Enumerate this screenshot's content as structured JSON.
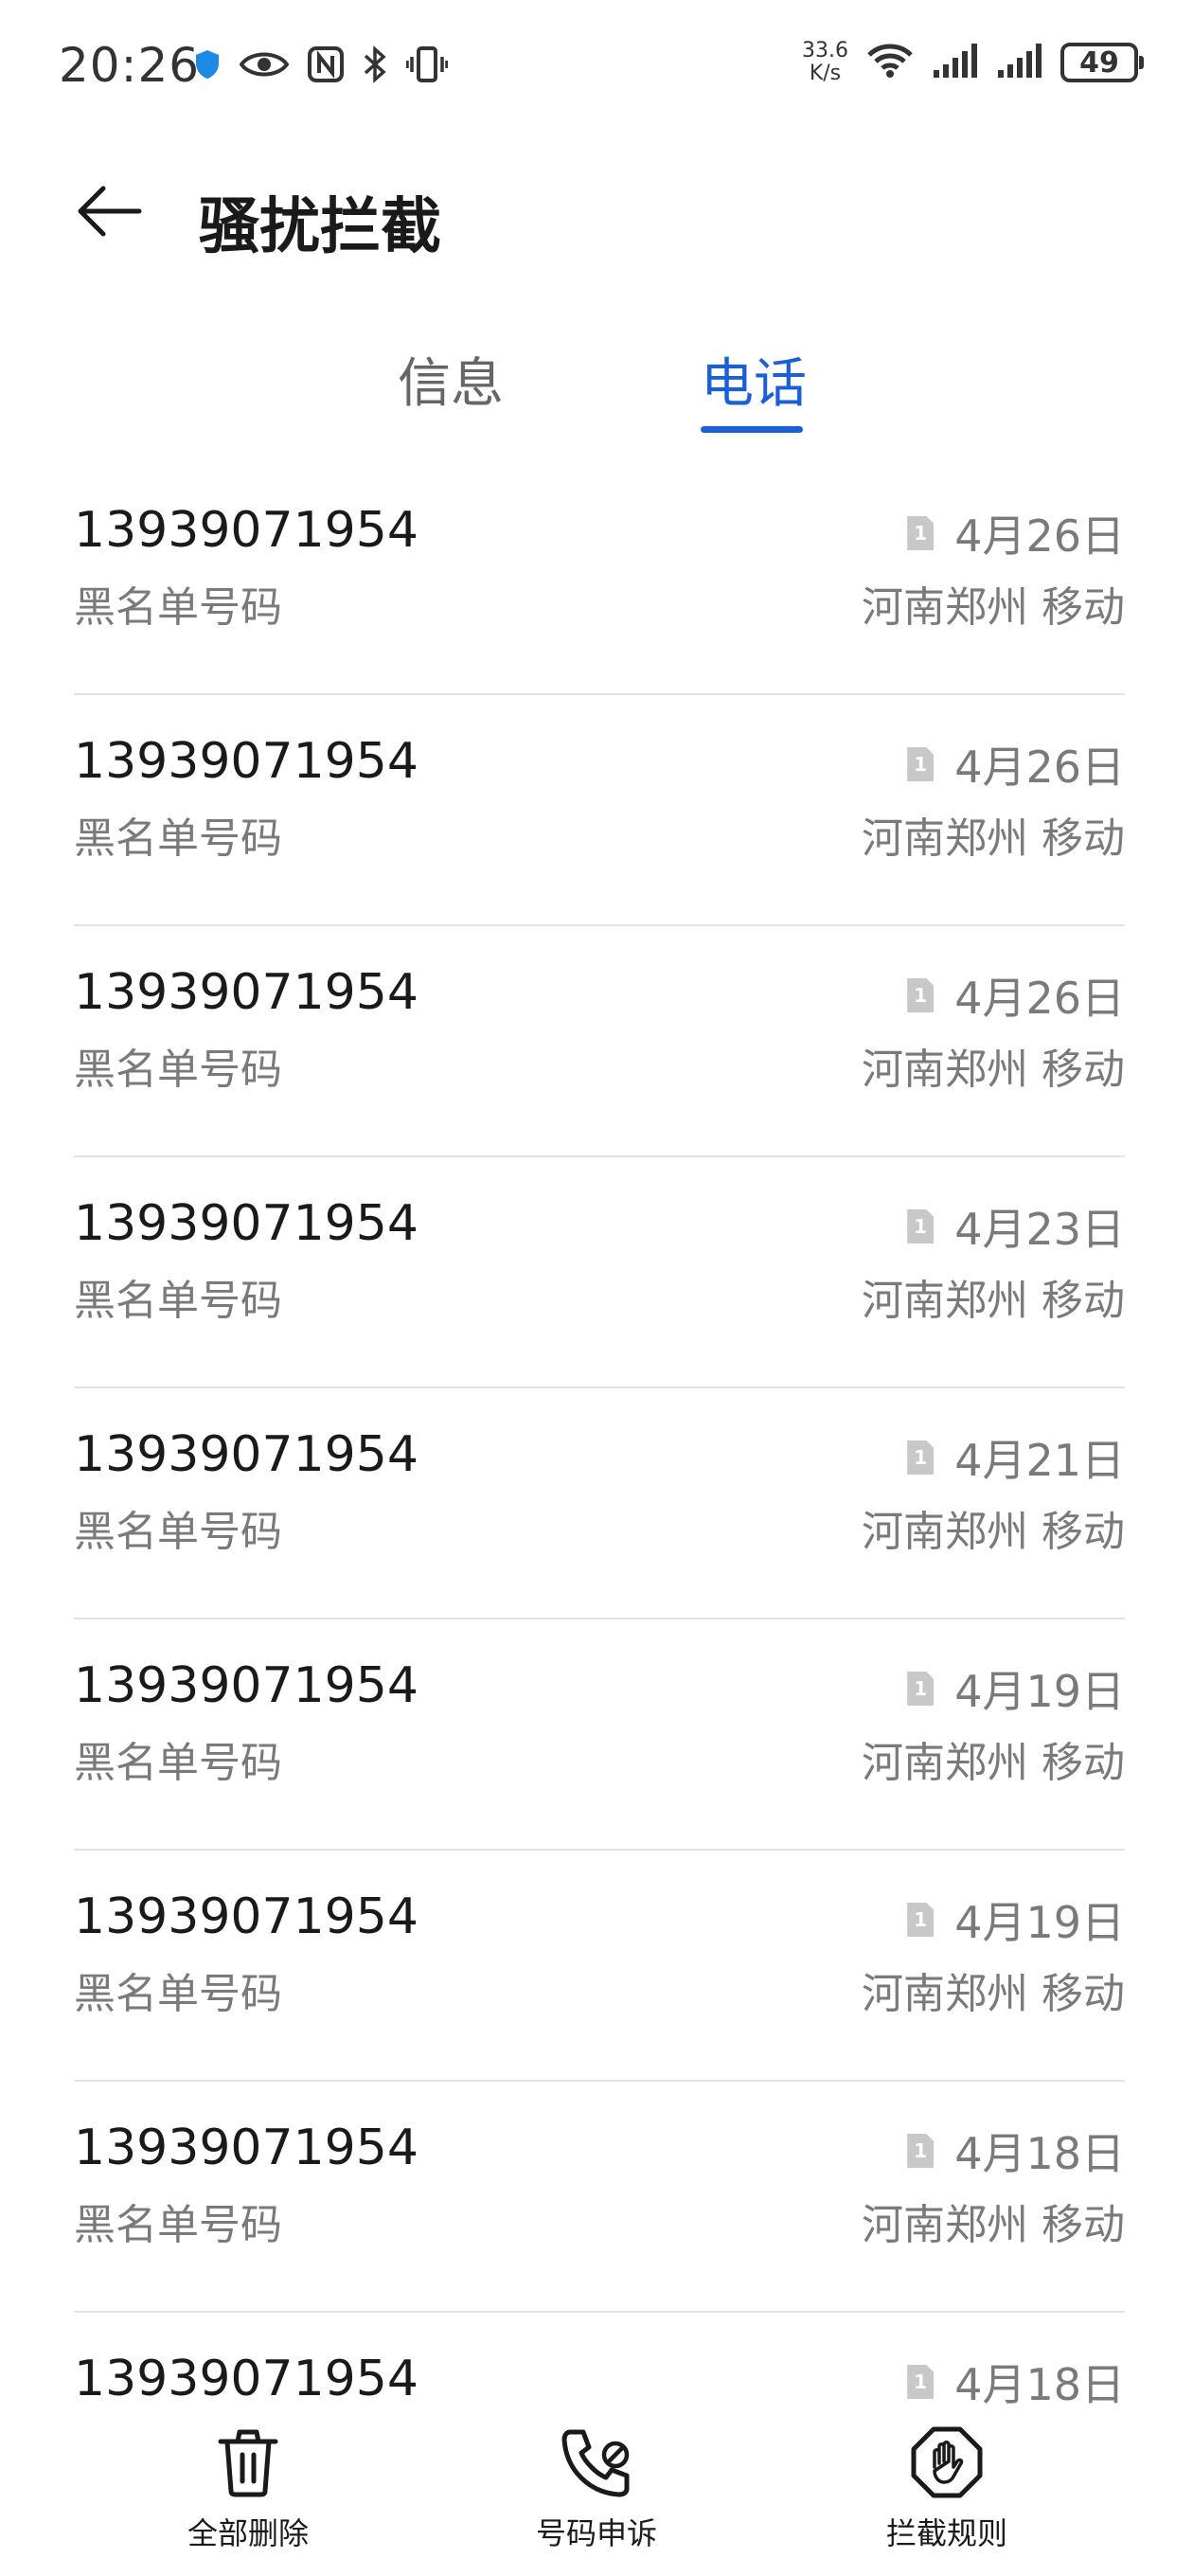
{
  "status_bar": {
    "time": "20:26",
    "net_speed_value": "33.6",
    "net_speed_unit": "K/s",
    "battery": "49",
    "icons": [
      "shield-icon",
      "eye-icon",
      "nfc-icon",
      "bluetooth-icon",
      "vibrate-icon",
      "wifi-icon",
      "signal-icon",
      "signal-icon"
    ]
  },
  "header": {
    "title": "骚扰拦截",
    "back_icon": "arrow-left-icon"
  },
  "tabs": [
    {
      "label": "信息",
      "active": false
    },
    {
      "label": "电话",
      "active": true
    }
  ],
  "colors": {
    "accent": "#1a5fd6",
    "secondary_text": "#7a7a7a",
    "divider": "#e2e2e2"
  },
  "calls": [
    {
      "number": "13939071954",
      "tag": "黑名单号码",
      "sim": "1",
      "date": "4月26日",
      "location": "河南郑州 移动"
    },
    {
      "number": "13939071954",
      "tag": "黑名单号码",
      "sim": "1",
      "date": "4月26日",
      "location": "河南郑州 移动"
    },
    {
      "number": "13939071954",
      "tag": "黑名单号码",
      "sim": "1",
      "date": "4月26日",
      "location": "河南郑州 移动"
    },
    {
      "number": "13939071954",
      "tag": "黑名单号码",
      "sim": "1",
      "date": "4月23日",
      "location": "河南郑州 移动"
    },
    {
      "number": "13939071954",
      "tag": "黑名单号码",
      "sim": "1",
      "date": "4月21日",
      "location": "河南郑州 移动"
    },
    {
      "number": "13939071954",
      "tag": "黑名单号码",
      "sim": "1",
      "date": "4月19日",
      "location": "河南郑州 移动"
    },
    {
      "number": "13939071954",
      "tag": "黑名单号码",
      "sim": "1",
      "date": "4月19日",
      "location": "河南郑州 移动"
    },
    {
      "number": "13939071954",
      "tag": "黑名单号码",
      "sim": "1",
      "date": "4月18日",
      "location": "河南郑州 移动"
    },
    {
      "number": "13939071954",
      "tag": "",
      "sim": "1",
      "date": "4月18日",
      "location": ""
    }
  ],
  "toolbar": {
    "delete_all_label": "全部删除",
    "delete_all_icon": "trash-icon",
    "appeal_label": "号码申诉",
    "appeal_icon": "phone-appeal-icon",
    "rules_label": "拦截规则",
    "rules_icon": "hand-stop-icon"
  }
}
